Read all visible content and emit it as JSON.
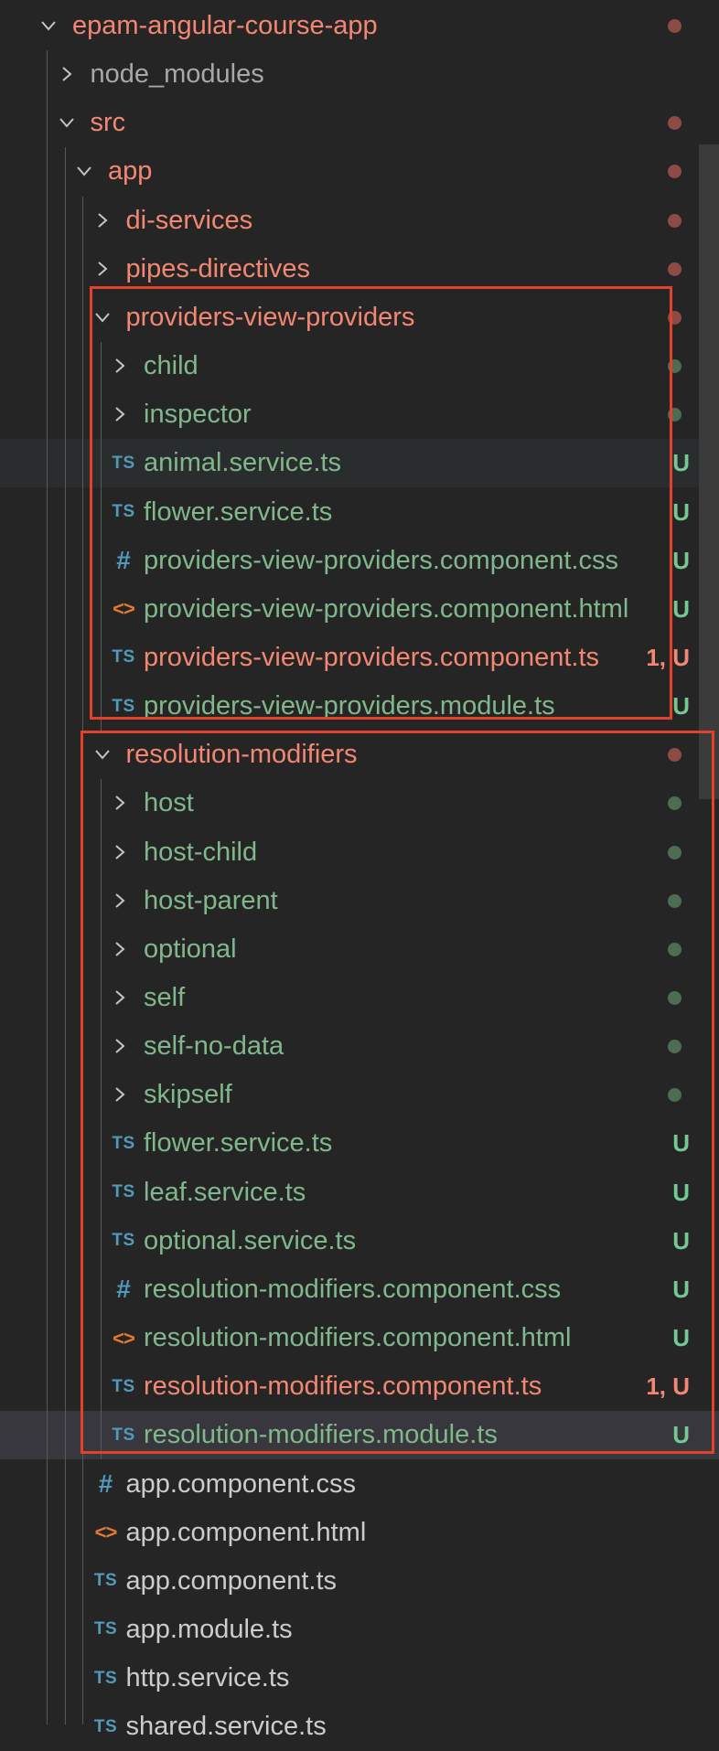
{
  "explorer": {
    "rows": [
      {
        "label": "epam-angular-course-app",
        "type": "folder",
        "expanded": true,
        "depth": 0,
        "color": "red",
        "dot": "red"
      },
      {
        "label": "node_modules",
        "type": "folder",
        "expanded": false,
        "depth": 1,
        "color": "gray"
      },
      {
        "label": "src",
        "type": "folder",
        "expanded": true,
        "depth": 1,
        "color": "red",
        "dot": "red"
      },
      {
        "label": "app",
        "type": "folder",
        "expanded": true,
        "depth": 2,
        "color": "red",
        "dot": "red"
      },
      {
        "label": "di-services",
        "type": "folder",
        "expanded": false,
        "depth": 3,
        "color": "red",
        "dot": "red"
      },
      {
        "label": "pipes-directives",
        "type": "folder",
        "expanded": false,
        "depth": 3,
        "color": "red",
        "dot": "red"
      },
      {
        "label": "providers-view-providers",
        "type": "folder",
        "expanded": true,
        "depth": 3,
        "color": "red",
        "dot": "red"
      },
      {
        "label": "child",
        "type": "folder",
        "expanded": false,
        "depth": 4,
        "color": "green",
        "dot": "green"
      },
      {
        "label": "inspector",
        "type": "folder",
        "expanded": false,
        "depth": 4,
        "color": "green",
        "dot": "green"
      },
      {
        "label": "animal.service.ts",
        "type": "ts",
        "depth": 4,
        "color": "green",
        "badge": "U",
        "hover": true
      },
      {
        "label": "flower.service.ts",
        "type": "ts",
        "depth": 4,
        "color": "green",
        "badge": "U"
      },
      {
        "label": "providers-view-providers.component.css",
        "type": "css",
        "depth": 4,
        "color": "green",
        "badge": "U"
      },
      {
        "label": "providers-view-providers.component.html",
        "type": "html",
        "depth": 4,
        "color": "green",
        "badge": "U"
      },
      {
        "label": "providers-view-providers.component.ts",
        "type": "ts",
        "depth": 4,
        "color": "red",
        "badge": "1, U",
        "badgeColor": "red"
      },
      {
        "label": "providers-view-providers.module.ts",
        "type": "ts",
        "depth": 4,
        "color": "green",
        "badge": "U"
      },
      {
        "label": "resolution-modifiers",
        "type": "folder",
        "expanded": true,
        "depth": 3,
        "color": "red",
        "dot": "red"
      },
      {
        "label": "host",
        "type": "folder",
        "expanded": false,
        "depth": 4,
        "color": "green",
        "dot": "green"
      },
      {
        "label": "host-child",
        "type": "folder",
        "expanded": false,
        "depth": 4,
        "color": "green",
        "dot": "green"
      },
      {
        "label": "host-parent",
        "type": "folder",
        "expanded": false,
        "depth": 4,
        "color": "green",
        "dot": "green"
      },
      {
        "label": "optional",
        "type": "folder",
        "expanded": false,
        "depth": 4,
        "color": "green",
        "dot": "green"
      },
      {
        "label": "self",
        "type": "folder",
        "expanded": false,
        "depth": 4,
        "color": "green",
        "dot": "green"
      },
      {
        "label": "self-no-data",
        "type": "folder",
        "expanded": false,
        "depth": 4,
        "color": "green",
        "dot": "green"
      },
      {
        "label": "skipself",
        "type": "folder",
        "expanded": false,
        "depth": 4,
        "color": "green",
        "dot": "green"
      },
      {
        "label": "flower.service.ts",
        "type": "ts",
        "depth": 4,
        "color": "green",
        "badge": "U"
      },
      {
        "label": "leaf.service.ts",
        "type": "ts",
        "depth": 4,
        "color": "green",
        "badge": "U"
      },
      {
        "label": "optional.service.ts",
        "type": "ts",
        "depth": 4,
        "color": "green",
        "badge": "U"
      },
      {
        "label": "resolution-modifiers.component.css",
        "type": "css",
        "depth": 4,
        "color": "green",
        "badge": "U"
      },
      {
        "label": "resolution-modifiers.component.html",
        "type": "html",
        "depth": 4,
        "color": "green",
        "badge": "U"
      },
      {
        "label": "resolution-modifiers.component.ts",
        "type": "ts",
        "depth": 4,
        "color": "red",
        "badge": "1, U",
        "badgeColor": "red"
      },
      {
        "label": "resolution-modifiers.module.ts",
        "type": "ts",
        "depth": 4,
        "color": "green",
        "badge": "U",
        "selected": true
      },
      {
        "label": "app.component.css",
        "type": "css",
        "depth": 3,
        "color": "white"
      },
      {
        "label": "app.component.html",
        "type": "html",
        "depth": 3,
        "color": "white"
      },
      {
        "label": "app.component.ts",
        "type": "ts",
        "depth": 3,
        "color": "white"
      },
      {
        "label": "app.module.ts",
        "type": "ts",
        "depth": 3,
        "color": "white"
      },
      {
        "label": "http.service.ts",
        "type": "ts",
        "depth": 3,
        "color": "white"
      },
      {
        "label": "shared.service.ts",
        "type": "ts",
        "depth": 3,
        "color": "white"
      }
    ]
  },
  "icons": {
    "ts": "TS",
    "css": "#",
    "html": "<>",
    "chevron_right": "chevron-right-icon",
    "chevron_down": "chevron-down-icon"
  },
  "colors": {
    "background": "#252526",
    "folder_modified": "#f48771",
    "untracked": "#81b88b",
    "highlight_box": "#e2412e"
  }
}
